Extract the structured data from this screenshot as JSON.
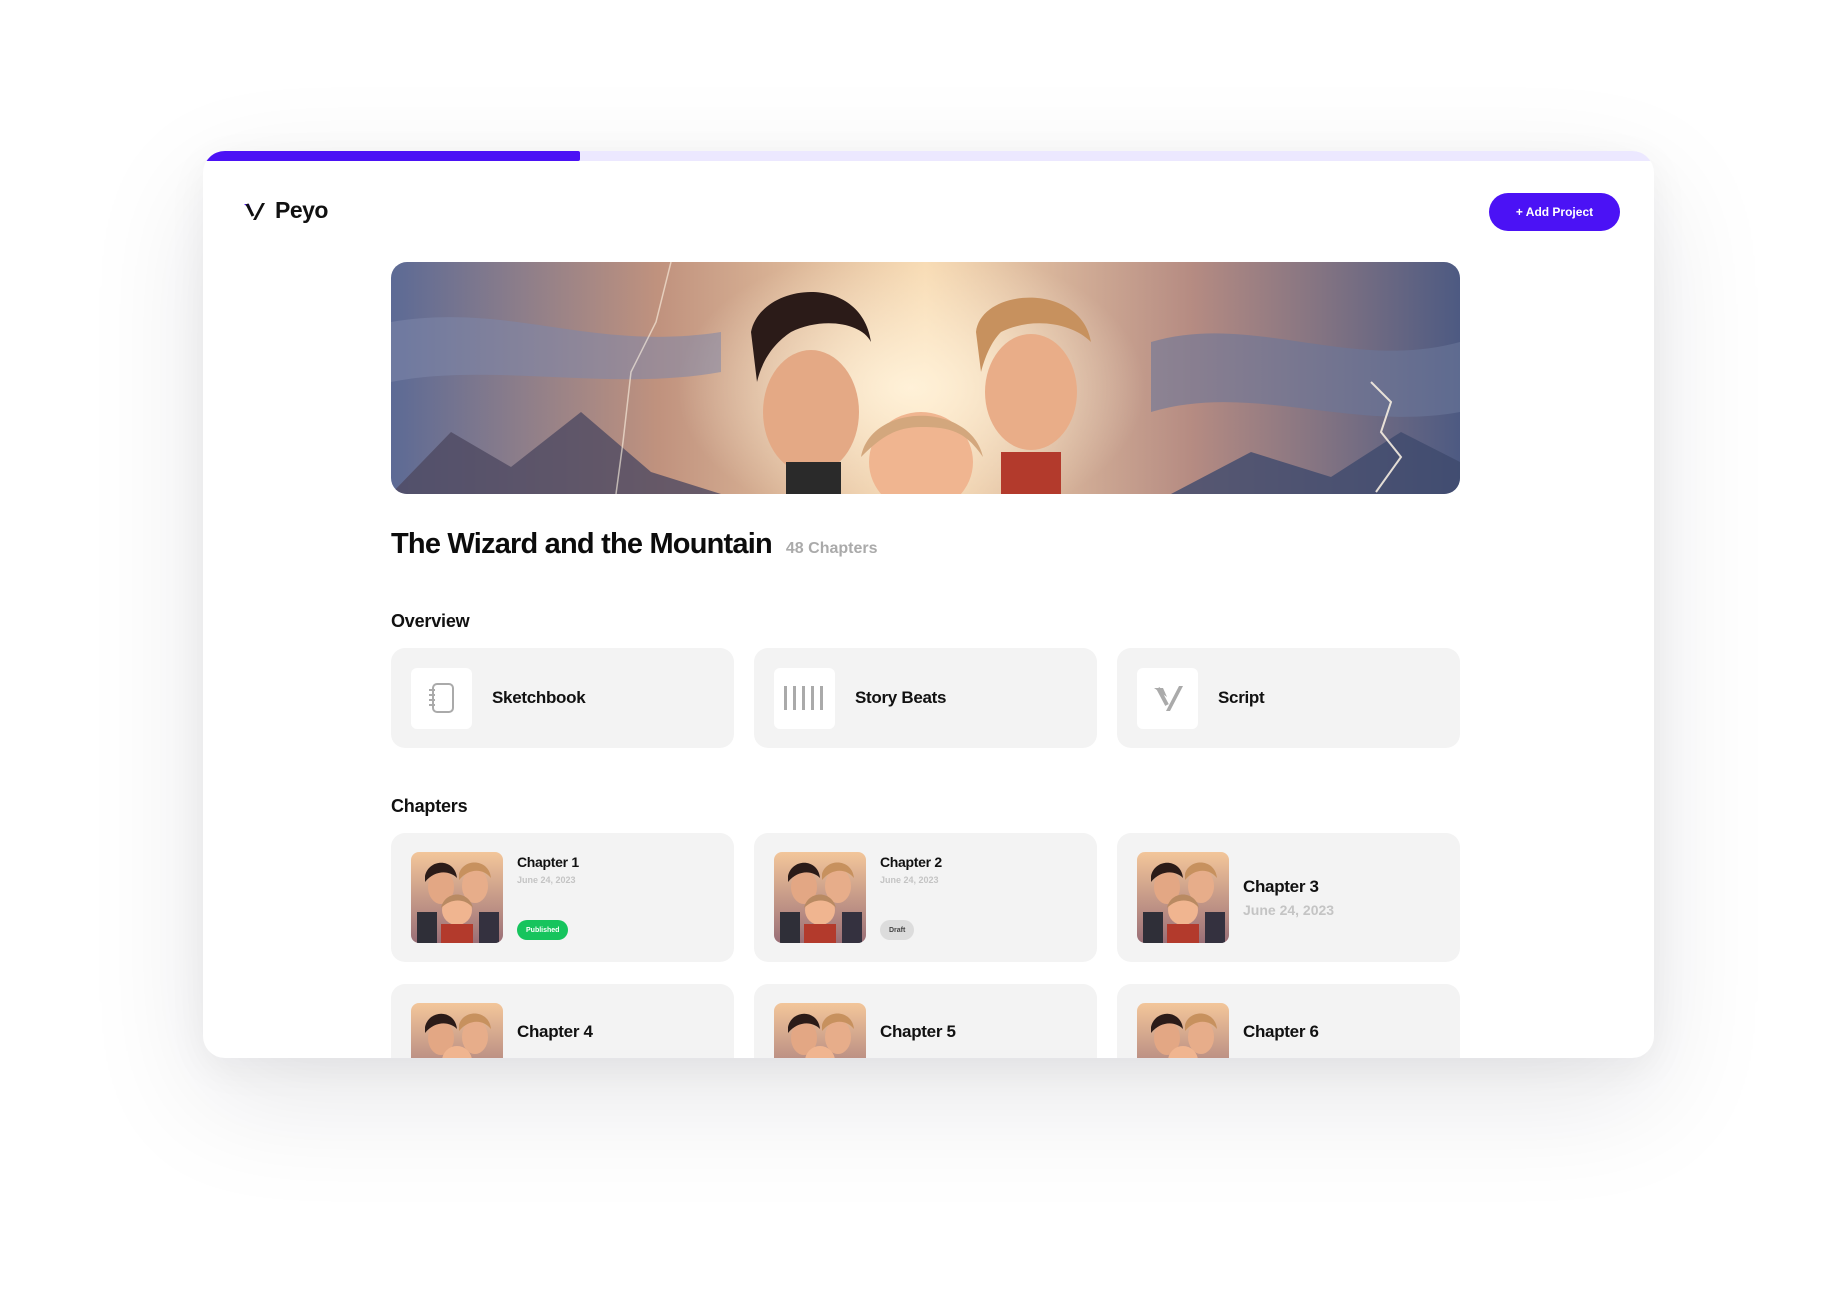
{
  "app": {
    "name": "Peyo",
    "brand_color": "#4b12f5"
  },
  "header": {
    "add_project_label": "+ Add Project"
  },
  "progress": {
    "fraction": 0.26
  },
  "project": {
    "title": "The Wizard and the Mountain",
    "chapter_count": "48 Chapters"
  },
  "overview": {
    "heading": "Overview",
    "items": [
      {
        "label": "Sketchbook",
        "icon": "notebook-icon"
      },
      {
        "label": "Story Beats",
        "icon": "story-beats-icon"
      },
      {
        "label": "Script",
        "icon": "script-icon"
      }
    ]
  },
  "chapters": {
    "heading": "Chapters",
    "items": [
      {
        "title": "Chapter 1",
        "date": "June 24, 2023",
        "status": "Published"
      },
      {
        "title": "Chapter 2",
        "date": "June 24, 2023",
        "status": "Draft"
      },
      {
        "title": "Chapter 3",
        "date": "June 24, 2023"
      },
      {
        "title": "Chapter 4"
      },
      {
        "title": "Chapter 5"
      },
      {
        "title": "Chapter 6"
      }
    ]
  },
  "colors": {
    "published": "#16c45d",
    "draft": "#dcdcdc",
    "card_bg": "#f3f3f3"
  }
}
